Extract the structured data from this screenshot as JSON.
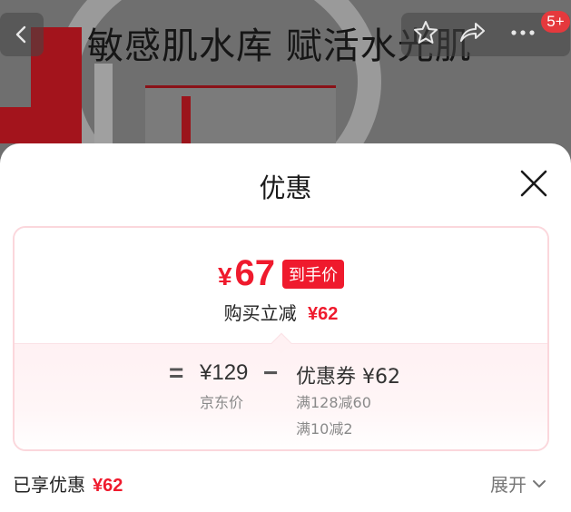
{
  "background": {
    "product_title": "敏感肌水库 赋活水光肌",
    "cart_badge": "5+"
  },
  "sheet": {
    "title": "优惠",
    "final_price": {
      "currency": "¥",
      "amount": "67",
      "tag": "到手价"
    },
    "saving": {
      "label": "购买立减",
      "amount": "¥62"
    },
    "calc": {
      "equals": "=",
      "minus": "−",
      "jd_price": "¥129",
      "jd_price_label": "京东价",
      "coupon_title": "优惠券 ¥62",
      "coupon_rules": [
        "满128减60",
        "满10减2"
      ]
    },
    "footer": {
      "enjoyed_label": "已享优惠",
      "enjoyed_amount": "¥62",
      "expand_label": "展开"
    }
  },
  "colors": {
    "accent_red": "#ef1a2d",
    "card_border": "#fbd7dc"
  },
  "icons": [
    "back-icon",
    "star-icon",
    "share-icon",
    "more-icon",
    "close-icon",
    "chevron-down-icon"
  ]
}
